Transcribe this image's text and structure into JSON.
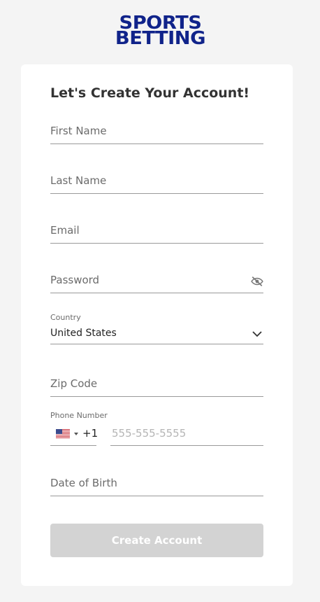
{
  "logo": {
    "line1": "SPORTS",
    "line2": "BETTING"
  },
  "form": {
    "title": "Let's Create Your Account!",
    "first_name_placeholder": "First Name",
    "last_name_placeholder": "Last Name",
    "email_placeholder": "Email",
    "password_placeholder": "Password",
    "country_label": "Country",
    "country_value": "United States",
    "zip_placeholder": "Zip Code",
    "phone_label": "Phone Number",
    "phone_dial_code": "+1",
    "phone_placeholder": "555-555-5555",
    "dob_placeholder": "Date of Birth",
    "submit_label": "Create Account"
  },
  "icons": {
    "password_toggle": "eye-off-icon",
    "country_dropdown": "chevron-down-icon",
    "phone_flag": "us-flag-icon"
  },
  "colors": {
    "brand": "#10238a",
    "button_disabled": "#d3d3d3",
    "text": "#333333",
    "placeholder": "#6b6b6b"
  }
}
